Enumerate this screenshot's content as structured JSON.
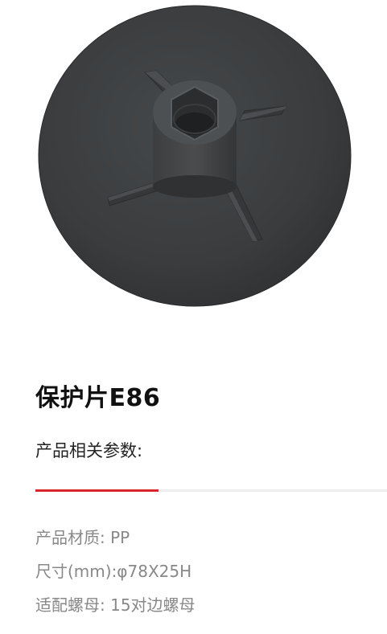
{
  "product": {
    "title": "保护片E86",
    "image_alt": "保护片E86"
  },
  "params": {
    "heading": "产品相关参数:",
    "specs": [
      "产品材质:  PP",
      "尺寸(mm):φ78X25H",
      "适配螺母:  15对边螺母"
    ]
  },
  "colors": {
    "accent": "#d8262b",
    "divider": "#eeeeee",
    "product_body": "#3b3d3f"
  }
}
